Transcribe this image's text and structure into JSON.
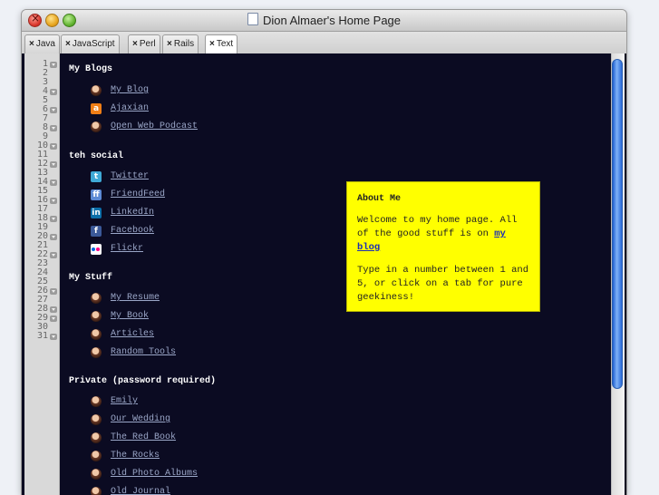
{
  "window": {
    "title": "Dion Almaer's Home Page"
  },
  "tabs": [
    {
      "close": "×",
      "label": "Java"
    },
    {
      "close": "×",
      "label": "JavaScript"
    },
    {
      "close": "×",
      "label": "Perl"
    },
    {
      "close": "×",
      "label": "Rails"
    },
    {
      "close": "×",
      "label": "Text"
    }
  ],
  "gutter": {
    "lines": [
      "1",
      "2",
      "3",
      "4",
      "5",
      "6",
      "7",
      "8",
      "9",
      "10",
      "11",
      "12",
      "13",
      "14",
      "15",
      "16",
      "17",
      "18",
      "19",
      "20",
      "21",
      "22",
      "23",
      "24",
      "25",
      "26",
      "27",
      "28",
      "29",
      "30",
      "31"
    ]
  },
  "sections": [
    {
      "heading": "My Blogs",
      "items": [
        {
          "icon": "avatar-icon",
          "label": "My Blog"
        },
        {
          "icon": "ajaxian-icon",
          "glyph": "a",
          "label": "Ajaxian"
        },
        {
          "icon": "avatar-icon",
          "label": "Open Web Podcast"
        }
      ]
    },
    {
      "heading": "teh social",
      "items": [
        {
          "icon": "twitter-icon",
          "glyph": "t",
          "label": "Twitter"
        },
        {
          "icon": "friendfeed-icon",
          "glyph": "ff",
          "label": "FriendFeed"
        },
        {
          "icon": "linkedin-icon",
          "glyph": "in",
          "label": "LinkedIn"
        },
        {
          "icon": "facebook-icon",
          "glyph": "f",
          "label": "Facebook"
        },
        {
          "icon": "flickr-icon",
          "label": "Flickr"
        }
      ]
    },
    {
      "heading": "My Stuff",
      "items": [
        {
          "icon": "avatar-icon",
          "label": "My Resume"
        },
        {
          "icon": "avatar-icon",
          "label": "My Book"
        },
        {
          "icon": "avatar-icon",
          "label": "Articles"
        },
        {
          "icon": "avatar-icon",
          "label": "Random Tools"
        }
      ]
    },
    {
      "heading": "Private (password required)",
      "items": [
        {
          "icon": "avatar-icon",
          "label": "Emily"
        },
        {
          "icon": "avatar-icon",
          "label": "Our Wedding"
        },
        {
          "icon": "avatar-icon",
          "label": "The Red Book"
        },
        {
          "icon": "avatar-icon",
          "label": "The Rocks"
        },
        {
          "icon": "avatar-icon",
          "label": "Old Photo Albums"
        },
        {
          "icon": "avatar-icon",
          "label": "Old Journal"
        }
      ]
    }
  ],
  "about": {
    "title": "About Me",
    "para1_before": "Welcome to my home page. All of the good stuff is on ",
    "para1_link": "my blog",
    "para2": "Type in a number between 1 and 5, or click on a tab for pure geekiness!"
  },
  "colors": {
    "editor_bg": "#0b0b22",
    "link": "#9aa6c7",
    "about_bg": "#ffff00",
    "scroll_thumb": "#3a7be0"
  }
}
